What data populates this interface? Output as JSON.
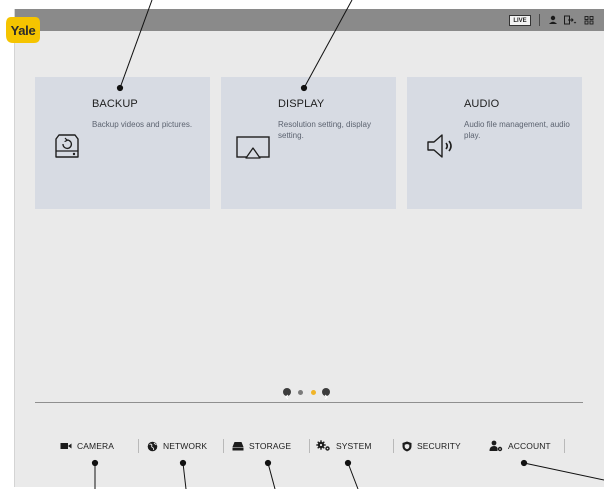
{
  "brand": {
    "logo_text": "Yale",
    "logo_color": "#f5c400"
  },
  "topbar": {
    "live_label": "LIVE",
    "icons": [
      "user-icon",
      "logout-icon",
      "grid-menu-icon"
    ]
  },
  "cards": [
    {
      "id": "backup",
      "title": "BACKUP",
      "description": "Backup videos and pictures.",
      "icon": "hard-drive-backup-icon"
    },
    {
      "id": "display",
      "title": "DISPLAY",
      "description": "Resolution setting, display setting.",
      "icon": "monitor-cast-icon"
    },
    {
      "id": "audio",
      "title": "AUDIO",
      "description": "Audio file management, audio play.",
      "icon": "speaker-icon"
    }
  ],
  "pager": {
    "pages": 2,
    "current": 2,
    "active_color": "#f0b428"
  },
  "nav": [
    {
      "id": "camera",
      "label": "CAMERA",
      "icon": "camera-icon"
    },
    {
      "id": "network",
      "label": "NETWORK",
      "icon": "globe-icon"
    },
    {
      "id": "storage",
      "label": "STORAGE",
      "icon": "storage-icon"
    },
    {
      "id": "system",
      "label": "SYSTEM",
      "icon": "gears-icon"
    },
    {
      "id": "security",
      "label": "SECURITY",
      "icon": "shield-icon"
    },
    {
      "id": "account",
      "label": "ACCOUNT",
      "icon": "account-gear-icon"
    }
  ],
  "colors": {
    "card_bg": "#d7dbe3",
    "topbar": "#8a8a8a",
    "background": "#eaeaea"
  }
}
